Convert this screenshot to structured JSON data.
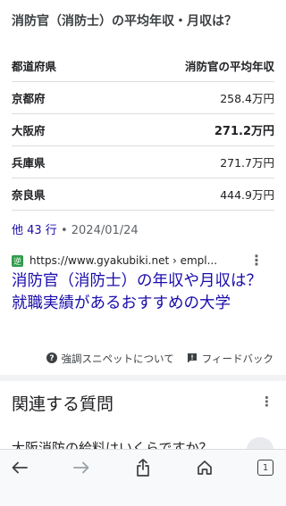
{
  "snippet": {
    "title": "消防官（消防士）の平均年収・月収は？"
  },
  "table": {
    "headers": [
      "都道府県",
      "消防官の平均年収"
    ],
    "rows": [
      {
        "prefecture": "京都府",
        "salary": "258.4万円"
      },
      {
        "prefecture": "大阪府",
        "salary": "271.2万円"
      },
      {
        "prefecture": "兵庫県",
        "salary": "271.7万円"
      },
      {
        "prefecture": "奈良県",
        "salary": "444.9万円"
      }
    ]
  },
  "more": {
    "rows_label": "他 43 行",
    "separator": "•",
    "date": "2024/01/24"
  },
  "source": {
    "favicon_text": "逆",
    "url": "https://www.gyakubiki.net › empl...",
    "menu": "⋮"
  },
  "result": {
    "title": "消防官（消防士）の年収や月収は？就職実績があるおすすめの大学"
  },
  "feedback": {
    "about_label": "強調スニペットについて",
    "feedback_label": "フィードバック"
  },
  "related": {
    "title": "関連する質問",
    "menu": "⋮",
    "first_question": "大阪消防の給料はいくらですか？"
  },
  "bottom_nav": {
    "tab_count": "1"
  }
}
